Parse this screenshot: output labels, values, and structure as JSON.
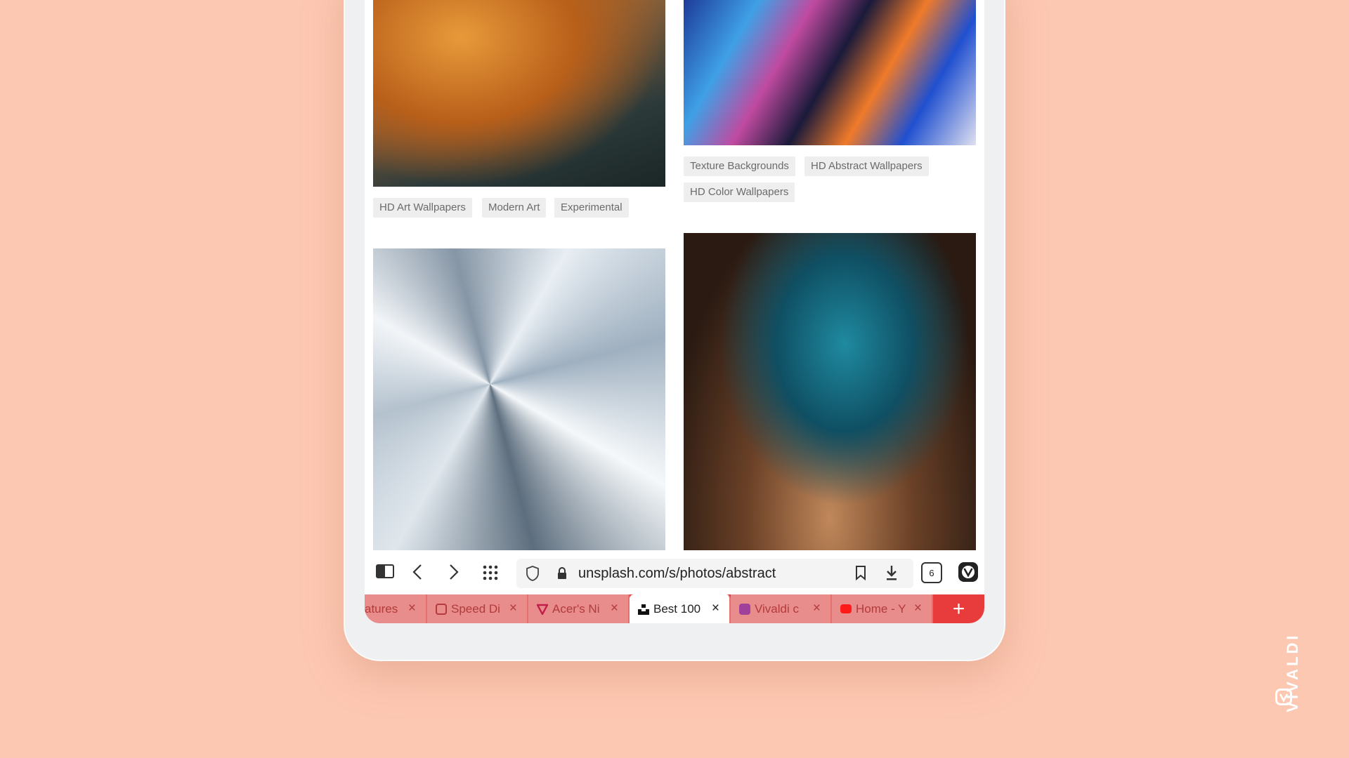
{
  "gallery": {
    "left_tags": [
      "HD Art Wallpapers",
      "Modern Art",
      "Experimental"
    ],
    "right_tags_row1": [
      "Texture Backgrounds",
      "HD Abstract Wallpapers"
    ],
    "right_tags_row2": [
      "HD Color Wallpapers"
    ]
  },
  "toolbar": {
    "url": "unsplash.com/s/photos/abstract",
    "tab_count": "6"
  },
  "tabs": [
    {
      "label": "atures",
      "icon": "generic",
      "active": false
    },
    {
      "label": "Speed Di",
      "icon": "vivaldi-icon",
      "active": false
    },
    {
      "label": "Acer's Ni",
      "icon": "vivaldi-v-icon",
      "active": false
    },
    {
      "label": "Best 100",
      "icon": "unsplash-icon",
      "active": true
    },
    {
      "label": "Vivaldi c",
      "icon": "vivaldi-icon",
      "active": false
    },
    {
      "label": "Home - Y",
      "icon": "youtube-icon",
      "active": false
    }
  ],
  "close_glyph": "×",
  "new_tab": "+",
  "brand": "VIVALDI",
  "colors": {
    "background": "#fdc8b2",
    "tabbar": "#e83c3c",
    "inactive_tab": "#e88c8c"
  }
}
